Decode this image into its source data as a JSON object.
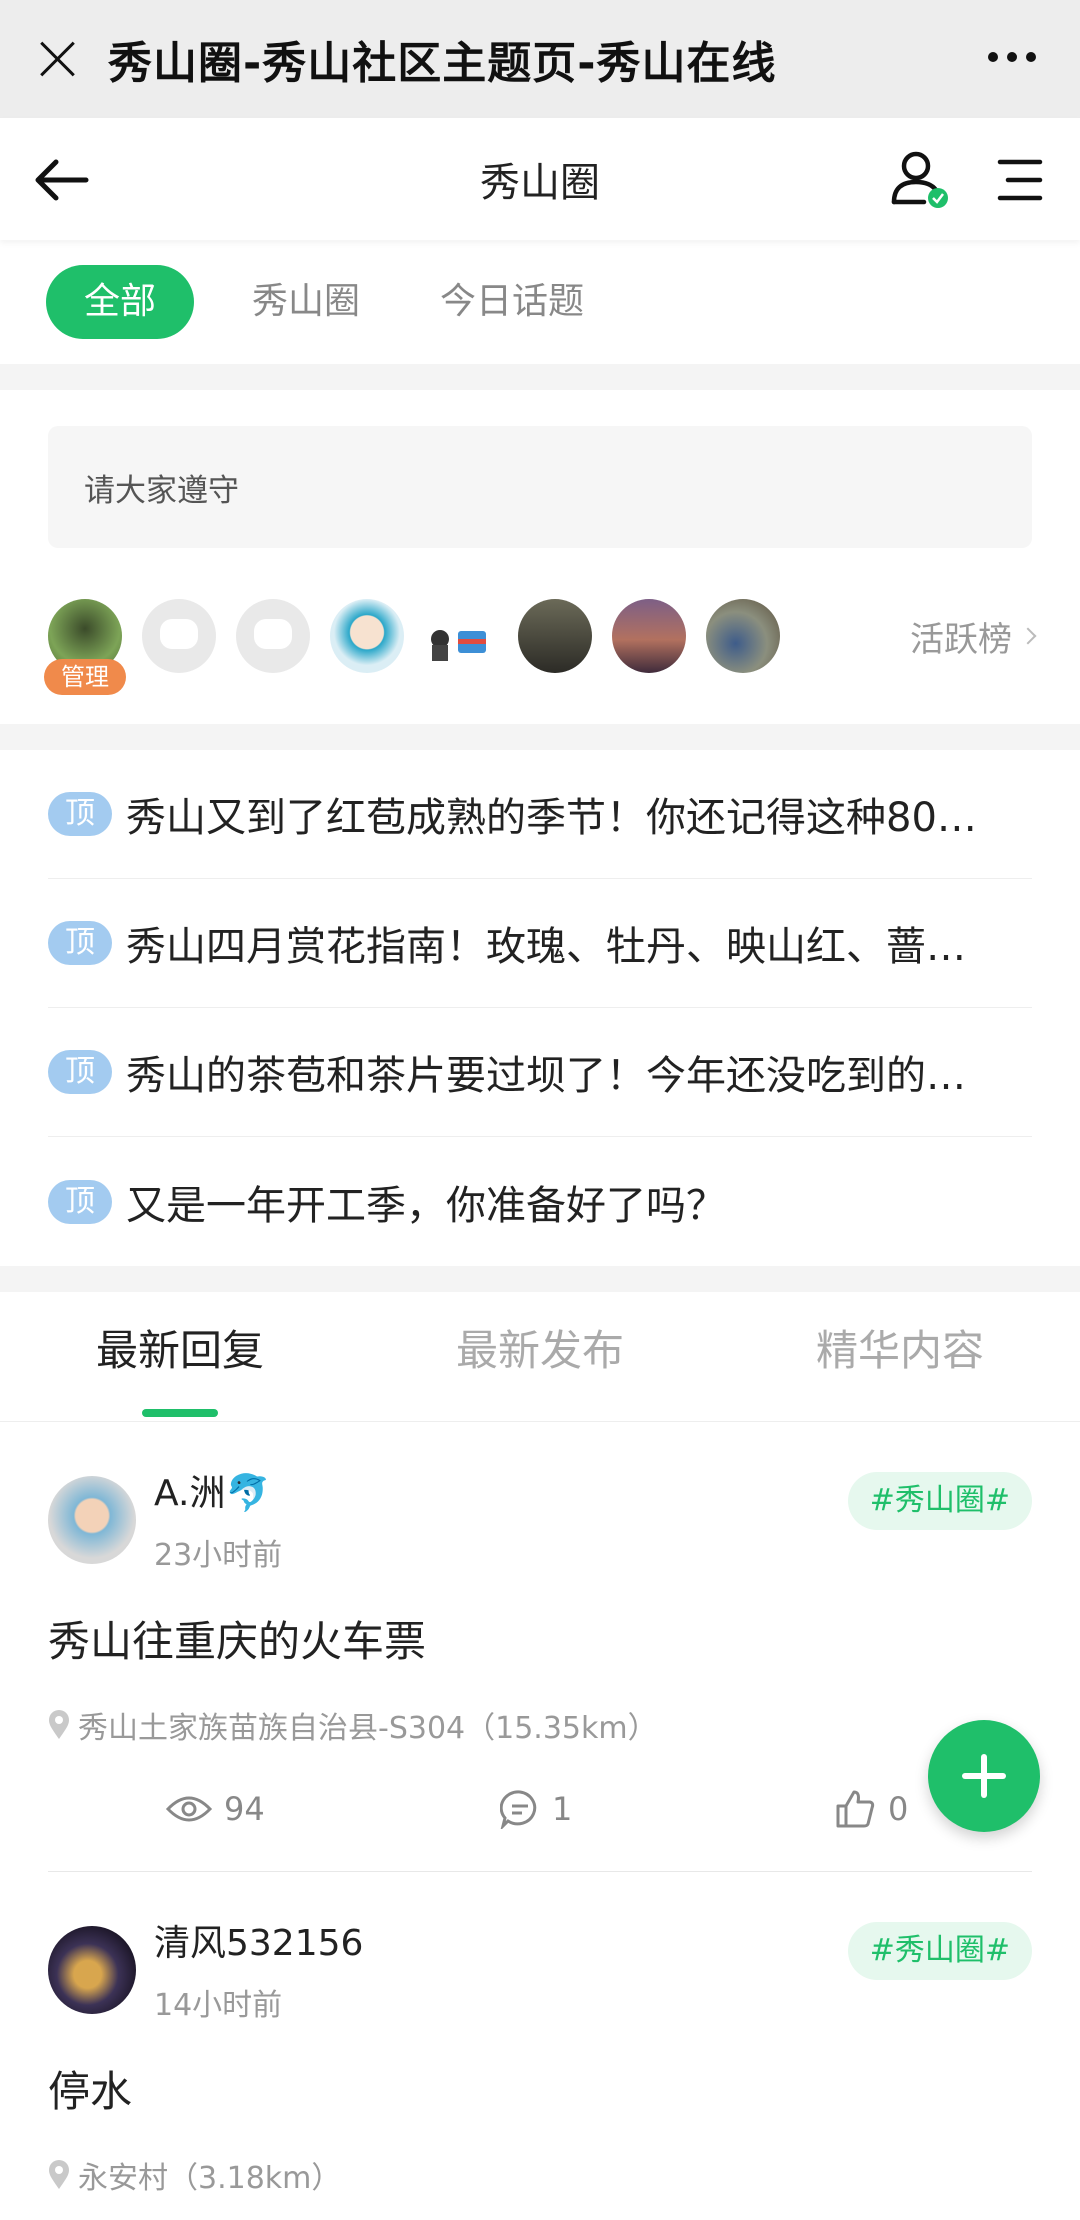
{
  "browser": {
    "title": "秀山圈-秀山社区主题页-秀山在线"
  },
  "nav": {
    "title": "秀山圈"
  },
  "filters": [
    {
      "label": "全部",
      "active": true
    },
    {
      "label": "秀山圈",
      "active": false
    },
    {
      "label": "今日话题",
      "active": false
    }
  ],
  "notice": "请大家遵守",
  "members": {
    "admin_tag": "管理",
    "rank_label": "活跃榜"
  },
  "pinned": {
    "tag": "顶",
    "items": [
      "秀山又到了红苞成熟的季节！你还记得这种80…",
      "秀山四月赏花指南！玫瑰、牡丹、映山红、蔷…",
      "秀山的茶苞和茶片要过坝了！今年还没吃到的…",
      "又是一年开工季，你准备好了吗？"
    ]
  },
  "tabs": [
    {
      "label": "最新回复",
      "active": true
    },
    {
      "label": "最新发布",
      "active": false
    },
    {
      "label": "精华内容",
      "active": false
    }
  ],
  "posts": [
    {
      "user": "A.洲🐬",
      "time": "23小时前",
      "topic": "#秀山圈#",
      "title": "秀山往重庆的火车票",
      "location": "秀山土家族苗族自治县-S304（15.35km）",
      "views": "94",
      "comments": "1",
      "likes": "0"
    },
    {
      "user": "清风532156",
      "time": "14小时前",
      "topic": "#秀山圈#",
      "title": "停水",
      "location": "永安村（3.18km）"
    }
  ],
  "colors": {
    "accent": "#1fbf6a",
    "pinned_tag": "#a3cbf0",
    "admin_tag": "#f08a4b"
  }
}
